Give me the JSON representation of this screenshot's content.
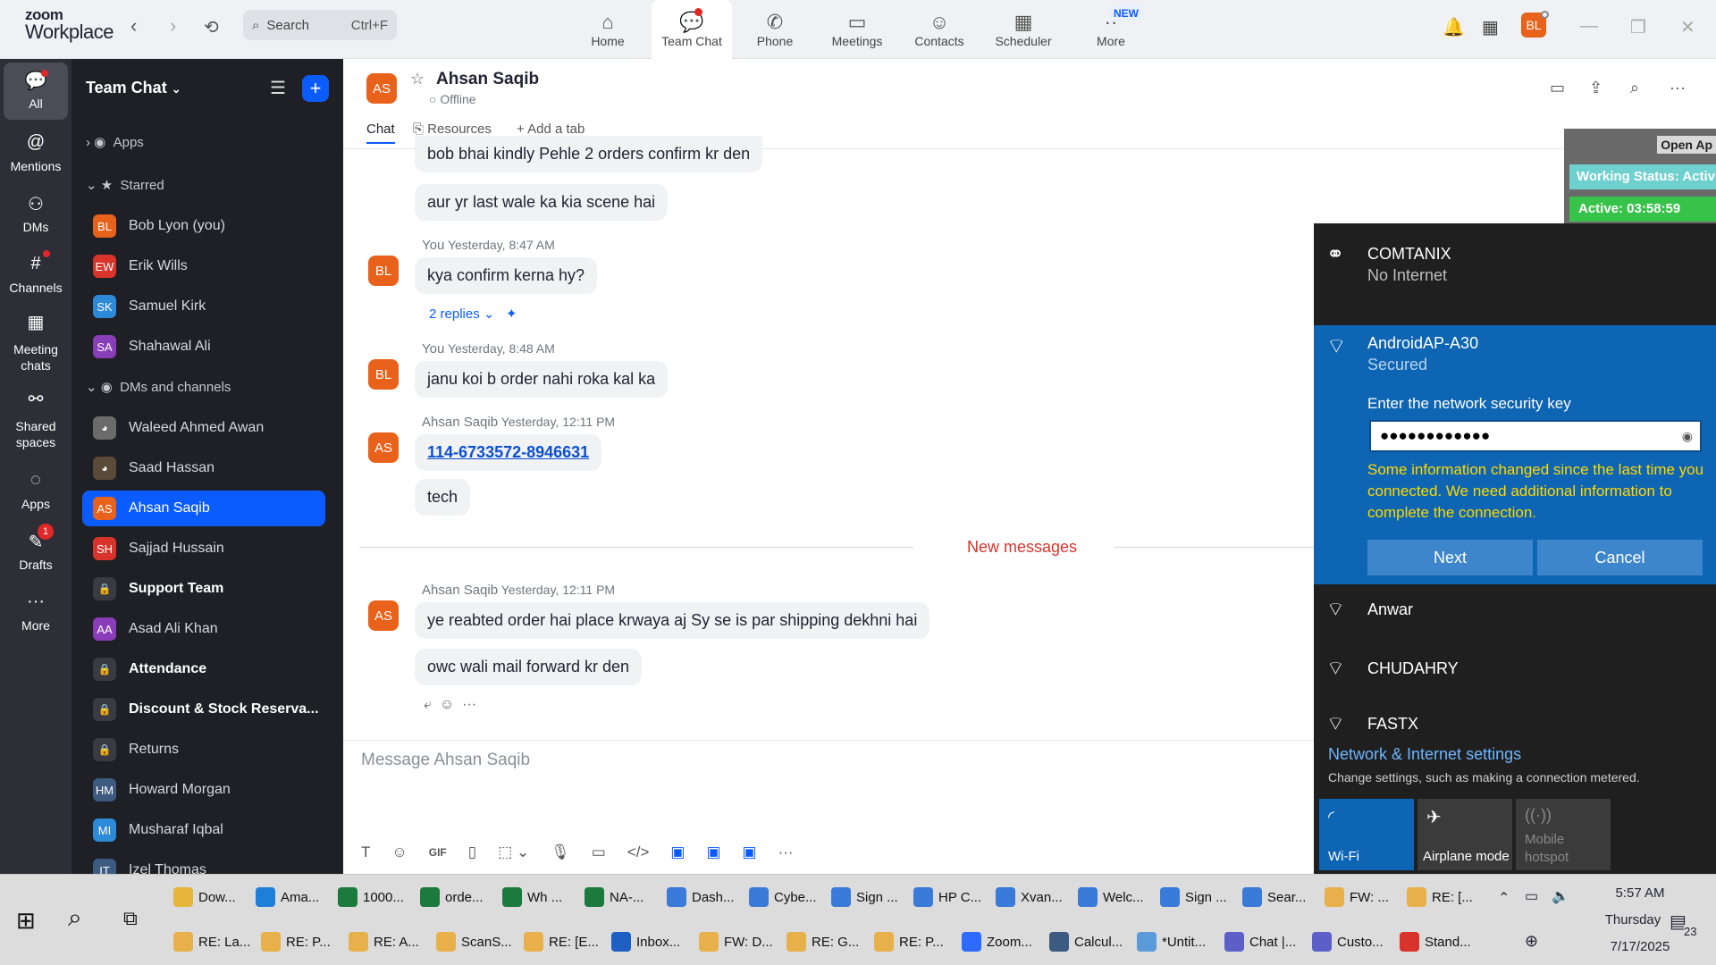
{
  "app": {
    "logo_line1": "zoom",
    "logo_line2": "Workplace"
  },
  "search": {
    "label": "Search",
    "shortcut": "Ctrl+F"
  },
  "nav_tabs": [
    {
      "label": "Home",
      "icon": "home-icon"
    },
    {
      "label": "Team Chat",
      "icon": "chat-icon"
    },
    {
      "label": "Phone",
      "icon": "phone-icon"
    },
    {
      "label": "Meetings",
      "icon": "video-icon"
    },
    {
      "label": "Contacts",
      "icon": "contacts-icon"
    },
    {
      "label": "Scheduler",
      "icon": "calendar-icon"
    },
    {
      "label": "More",
      "icon": "more-icon"
    }
  ],
  "new_badge": "NEW",
  "user_avatar": "BL",
  "rail": [
    {
      "label": "All"
    },
    {
      "label": "Mentions"
    },
    {
      "label": "DMs"
    },
    {
      "label": "Channels"
    },
    {
      "label": "Meeting chats"
    },
    {
      "label": "Shared spaces"
    },
    {
      "label": "Apps"
    },
    {
      "label": "Drafts",
      "badge": "1"
    },
    {
      "label": "More"
    }
  ],
  "sidebar": {
    "title": "Team Chat",
    "sections": {
      "apps": "Apps",
      "starred": "Starred",
      "dms": "DMs and channels"
    },
    "starred": [
      {
        "initials": "BL",
        "name": "Bob Lyon (you)",
        "color": "#e8621c"
      },
      {
        "initials": "EW",
        "name": "Erik Wills",
        "color": "#d9342b"
      },
      {
        "initials": "SK",
        "name": "Samuel Kirk",
        "color": "#2d8ad9"
      },
      {
        "initials": "SA",
        "name": "Shahawal Ali",
        "color": "#8a3db8"
      }
    ],
    "items": [
      {
        "initials": "",
        "name": "Waleed Ahmed Awan",
        "color": "#6b6b6b"
      },
      {
        "initials": "",
        "name": "Saad Hassan",
        "color": "#5a4a3a"
      },
      {
        "initials": "AS",
        "name": "Ahsan Saqib",
        "color": "#e8621c"
      },
      {
        "initials": "SH",
        "name": "Sajjad Hussain",
        "color": "#d9342b"
      },
      {
        "initials": "",
        "name": "Support Team",
        "color": "#3a3b42",
        "bold": true
      },
      {
        "initials": "AA",
        "name": "Asad Ali Khan",
        "color": "#8a3db8"
      },
      {
        "initials": "",
        "name": "Attendance",
        "color": "#3a3b42",
        "bold": true
      },
      {
        "initials": "",
        "name": "Discount & Stock Reserva...",
        "color": "#3a3b42",
        "bold": true
      },
      {
        "initials": "",
        "name": "Returns",
        "color": "#3a3b42"
      },
      {
        "initials": "HM",
        "name": "Howard Morgan",
        "color": "#3d5a80"
      },
      {
        "initials": "MI",
        "name": "Musharaf Iqbal",
        "color": "#2d8ad9"
      },
      {
        "initials": "IT",
        "name": "Izel Thomas",
        "color": "#3d5a80"
      }
    ]
  },
  "chat": {
    "contact_initials": "AS",
    "contact_name": "Ahsan Saqib",
    "contact_status": "Offline",
    "tabs": [
      "Chat",
      "Resources",
      "Add a tab"
    ],
    "messages": [
      {
        "text": "bob bhai kindly Pehle 2 orders confirm kr den"
      },
      {
        "text": "aur yr last wale ka kia scene hai"
      },
      {
        "sender": "You",
        "time": "Yesterday, 8:47 AM",
        "text": "kya confirm kerna hy?",
        "avatar": "BL"
      },
      {
        "replies": "2 replies"
      },
      {
        "sender": "You",
        "time": "Yesterday, 8:48 AM",
        "text": "janu koi b order nahi roka kal ka",
        "avatar": "BL"
      },
      {
        "sender": "Ahsan Saqib",
        "time": "Yesterday, 12:11 PM",
        "text": "114-6733572-8946631",
        "avatar": "AS"
      },
      {
        "text": "tech"
      },
      {
        "sender": "Ahsan Saqib",
        "time": "Yesterday, 12:11 PM",
        "text": "ye reabted order hai place krwaya aj Sy se is par shipping dekhni hai",
        "avatar": "AS"
      },
      {
        "text": "owc wali mail forward kr den"
      }
    ],
    "new_messages_label": "New messages",
    "composer_placeholder": "Message Ahsan Saqib"
  },
  "status_overlay": {
    "open_app": "Open Ap",
    "working": "Working Status: Activ",
    "active": "Active: 03:58:59"
  },
  "wifi": {
    "current": {
      "name": "COMTANIX",
      "status": "No Internet"
    },
    "selected": {
      "name": "AndroidAP-A30",
      "status": "Secured",
      "prompt": "Enter the network security key",
      "password": "●●●●●●●●●●●●",
      "warning": "Some information changed since the last time you connected. We need additional information to complete the connection.",
      "next": "Next",
      "cancel": "Cancel"
    },
    "others": [
      "Anwar",
      "CHUDAHRY",
      "FASTX"
    ],
    "settings_title": "Network & Internet settings",
    "settings_sub": "Change settings, such as making a connection metered.",
    "quick": [
      "Wi-Fi",
      "Airplane mode",
      "Mobile hotspot"
    ]
  },
  "taskbar": {
    "row1": [
      "Dow...",
      "Ama...",
      "1000...",
      "orde...",
      "Wh ...",
      "NA-...",
      "Dash...",
      "Cybe...",
      "Sign ...",
      "HP C...",
      "Xvan...",
      "Welc...",
      "Sign ...",
      "Sear...",
      "FW: ...",
      "RE: [..."
    ],
    "row2": [
      "RE: La...",
      "RE: P...",
      "RE: A...",
      "ScanS...",
      "RE: [E...",
      "Inbox...",
      "FW: D...",
      "RE: G...",
      "RE: P...",
      "Zoom...",
      "Calcul...",
      "*Untit...",
      "Chat |...",
      "Custo...",
      "Stand..."
    ],
    "time": "5:57 AM",
    "day": "Thursday",
    "date": "7/17/2025",
    "notif_count": "23"
  }
}
